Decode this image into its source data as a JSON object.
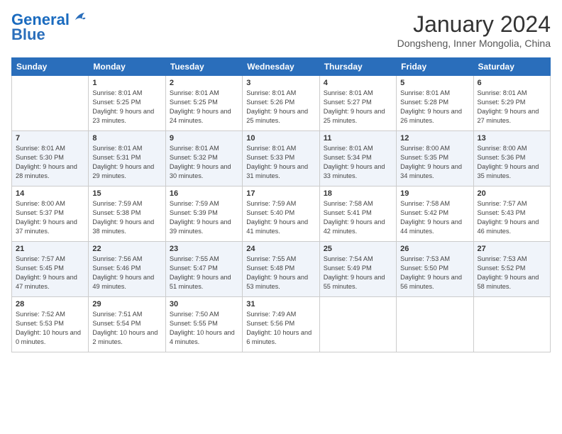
{
  "header": {
    "logo_line1": "General",
    "logo_line2": "Blue",
    "month": "January 2024",
    "location": "Dongsheng, Inner Mongolia, China"
  },
  "days_of_week": [
    "Sunday",
    "Monday",
    "Tuesday",
    "Wednesday",
    "Thursday",
    "Friday",
    "Saturday"
  ],
  "weeks": [
    [
      {
        "num": "",
        "empty": true
      },
      {
        "num": "1",
        "sunrise": "8:01 AM",
        "sunset": "5:25 PM",
        "daylight": "9 hours and 23 minutes."
      },
      {
        "num": "2",
        "sunrise": "8:01 AM",
        "sunset": "5:25 PM",
        "daylight": "9 hours and 24 minutes."
      },
      {
        "num": "3",
        "sunrise": "8:01 AM",
        "sunset": "5:26 PM",
        "daylight": "9 hours and 25 minutes."
      },
      {
        "num": "4",
        "sunrise": "8:01 AM",
        "sunset": "5:27 PM",
        "daylight": "9 hours and 25 minutes."
      },
      {
        "num": "5",
        "sunrise": "8:01 AM",
        "sunset": "5:28 PM",
        "daylight": "9 hours and 26 minutes."
      },
      {
        "num": "6",
        "sunrise": "8:01 AM",
        "sunset": "5:29 PM",
        "daylight": "9 hours and 27 minutes."
      }
    ],
    [
      {
        "num": "7",
        "sunrise": "8:01 AM",
        "sunset": "5:30 PM",
        "daylight": "9 hours and 28 minutes."
      },
      {
        "num": "8",
        "sunrise": "8:01 AM",
        "sunset": "5:31 PM",
        "daylight": "9 hours and 29 minutes."
      },
      {
        "num": "9",
        "sunrise": "8:01 AM",
        "sunset": "5:32 PM",
        "daylight": "9 hours and 30 minutes."
      },
      {
        "num": "10",
        "sunrise": "8:01 AM",
        "sunset": "5:33 PM",
        "daylight": "9 hours and 31 minutes."
      },
      {
        "num": "11",
        "sunrise": "8:01 AM",
        "sunset": "5:34 PM",
        "daylight": "9 hours and 33 minutes."
      },
      {
        "num": "12",
        "sunrise": "8:00 AM",
        "sunset": "5:35 PM",
        "daylight": "9 hours and 34 minutes."
      },
      {
        "num": "13",
        "sunrise": "8:00 AM",
        "sunset": "5:36 PM",
        "daylight": "9 hours and 35 minutes."
      }
    ],
    [
      {
        "num": "14",
        "sunrise": "8:00 AM",
        "sunset": "5:37 PM",
        "daylight": "9 hours and 37 minutes."
      },
      {
        "num": "15",
        "sunrise": "7:59 AM",
        "sunset": "5:38 PM",
        "daylight": "9 hours and 38 minutes."
      },
      {
        "num": "16",
        "sunrise": "7:59 AM",
        "sunset": "5:39 PM",
        "daylight": "9 hours and 39 minutes."
      },
      {
        "num": "17",
        "sunrise": "7:59 AM",
        "sunset": "5:40 PM",
        "daylight": "9 hours and 41 minutes."
      },
      {
        "num": "18",
        "sunrise": "7:58 AM",
        "sunset": "5:41 PM",
        "daylight": "9 hours and 42 minutes."
      },
      {
        "num": "19",
        "sunrise": "7:58 AM",
        "sunset": "5:42 PM",
        "daylight": "9 hours and 44 minutes."
      },
      {
        "num": "20",
        "sunrise": "7:57 AM",
        "sunset": "5:43 PM",
        "daylight": "9 hours and 46 minutes."
      }
    ],
    [
      {
        "num": "21",
        "sunrise": "7:57 AM",
        "sunset": "5:45 PM",
        "daylight": "9 hours and 47 minutes."
      },
      {
        "num": "22",
        "sunrise": "7:56 AM",
        "sunset": "5:46 PM",
        "daylight": "9 hours and 49 minutes."
      },
      {
        "num": "23",
        "sunrise": "7:55 AM",
        "sunset": "5:47 PM",
        "daylight": "9 hours and 51 minutes."
      },
      {
        "num": "24",
        "sunrise": "7:55 AM",
        "sunset": "5:48 PM",
        "daylight": "9 hours and 53 minutes."
      },
      {
        "num": "25",
        "sunrise": "7:54 AM",
        "sunset": "5:49 PM",
        "daylight": "9 hours and 55 minutes."
      },
      {
        "num": "26",
        "sunrise": "7:53 AM",
        "sunset": "5:50 PM",
        "daylight": "9 hours and 56 minutes."
      },
      {
        "num": "27",
        "sunrise": "7:53 AM",
        "sunset": "5:52 PM",
        "daylight": "9 hours and 58 minutes."
      }
    ],
    [
      {
        "num": "28",
        "sunrise": "7:52 AM",
        "sunset": "5:53 PM",
        "daylight": "10 hours and 0 minutes."
      },
      {
        "num": "29",
        "sunrise": "7:51 AM",
        "sunset": "5:54 PM",
        "daylight": "10 hours and 2 minutes."
      },
      {
        "num": "30",
        "sunrise": "7:50 AM",
        "sunset": "5:55 PM",
        "daylight": "10 hours and 4 minutes."
      },
      {
        "num": "31",
        "sunrise": "7:49 AM",
        "sunset": "5:56 PM",
        "daylight": "10 hours and 6 minutes."
      },
      {
        "num": "",
        "empty": true
      },
      {
        "num": "",
        "empty": true
      },
      {
        "num": "",
        "empty": true
      }
    ]
  ]
}
